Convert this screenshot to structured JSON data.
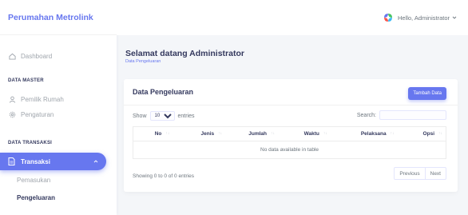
{
  "sidebar": {
    "brand": "Perumahan Metrolink",
    "dashboard": "Dashboard",
    "header_master": "DATA MASTER",
    "pemilik": "Pemilik Rumah",
    "pengaturan": "Pengaturan",
    "header_transaksi": "DATA TRANSAKSI",
    "transaksi": "Transaksi",
    "pemasukan": "Pemasukan",
    "pengeluaran": "Pengeluaran"
  },
  "topbar": {
    "user": "Hello, Administrator"
  },
  "page": {
    "title": "Selamat datang Administrator",
    "subtitle": "Data Pengeluaran"
  },
  "card": {
    "title": "Data Pengeluaran",
    "add_button": "Tambah Data",
    "show": "Show",
    "entries_value": "10",
    "entries": "entries",
    "search": "Search:"
  },
  "table": {
    "columns": [
      "No",
      "Jenis",
      "Jumlah",
      "Waktu",
      "Pelaksana",
      "Opsi"
    ],
    "empty": "No data available in table"
  },
  "footer": {
    "info": "Showing 0 to 0 of 0 entries",
    "previous": "Previous",
    "next": "Next"
  },
  "colors": {
    "accent": "#6777ef",
    "background": "#f4f6f9"
  }
}
